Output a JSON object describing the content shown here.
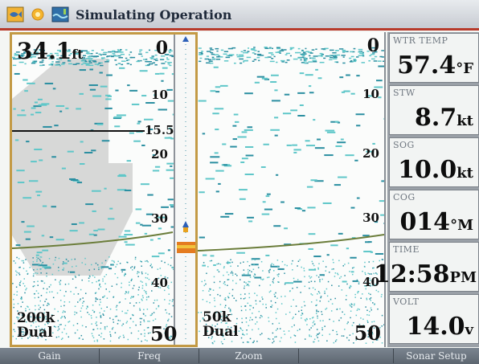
{
  "title_bar": {
    "title": "Simulating Operation",
    "icons": [
      "fish-icon",
      "sun-icon",
      "water-icon"
    ]
  },
  "left_panel": {
    "depth_reading": "34.1",
    "depth_unit": "ft",
    "scale_top": "0",
    "scale_labels": [
      "10",
      "20",
      "30",
      "40"
    ],
    "depth_cursor_label": "15.5",
    "frequency": "200k",
    "mode": "Dual",
    "scale_bottom": "50"
  },
  "right_panel": {
    "scale_top": "0",
    "scale_labels": [
      "10",
      "20",
      "30",
      "40"
    ],
    "frequency": "50k",
    "mode": "Dual",
    "scale_bottom": "50"
  },
  "data_fields": [
    {
      "label": "WTR TEMP",
      "value": "57.4",
      "unit": "°F"
    },
    {
      "label": "STW",
      "value": "8.7",
      "unit": "kt"
    },
    {
      "label": "SOG",
      "value": "10.0",
      "unit": "kt"
    },
    {
      "label": "COG",
      "value": "014",
      "unit": "°M"
    },
    {
      "label": "TIME",
      "value": "12:58",
      "unit": "PM"
    },
    {
      "label": "VOLT",
      "value": "14.0",
      "unit": "v"
    }
  ],
  "softkeys": [
    "Gain",
    "Freq",
    "Zoom",
    "",
    "Sonar Setup"
  ],
  "colors": {
    "echo": "#5fc7c9",
    "echo_dark": "#2b8fa1",
    "panel_border": "#c39a45",
    "title_underline": "#b73a2b",
    "softkey_bg": "#6b7480"
  }
}
